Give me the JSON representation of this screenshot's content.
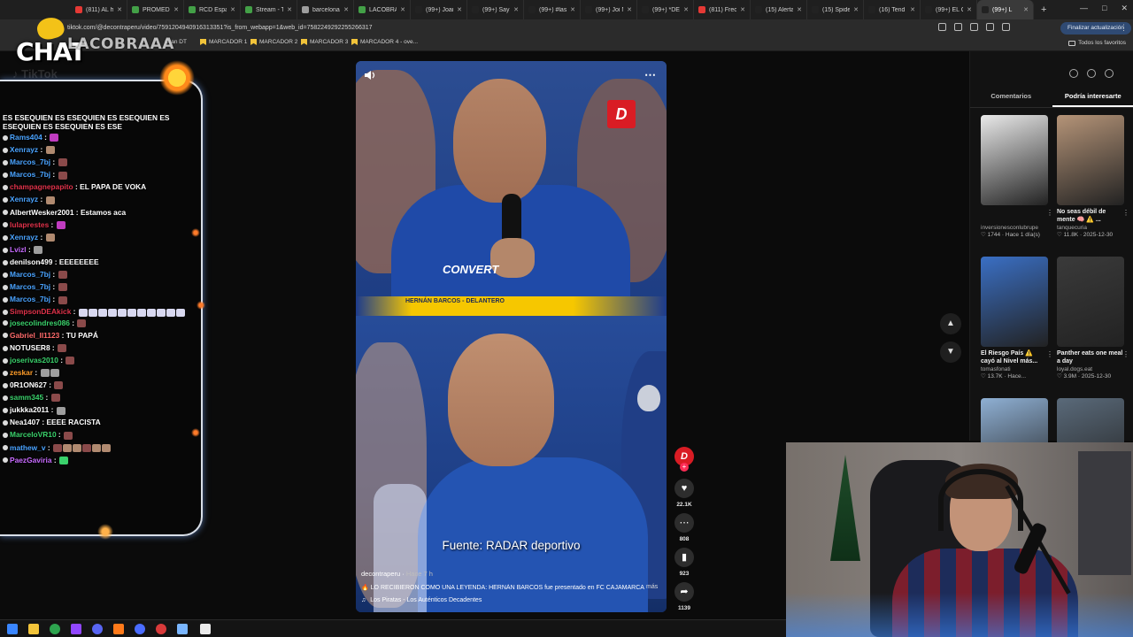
{
  "browser": {
    "tabs": [
      {
        "label": "(811) AL hi",
        "color": "#e53935"
      },
      {
        "label": "PROMEDI",
        "color": "#43a047"
      },
      {
        "label": "RCD Espa",
        "color": "#43a047"
      },
      {
        "label": "Stream - T",
        "color": "#43a047"
      },
      {
        "label": "barcelona",
        "color": "#9e9e9e"
      },
      {
        "label": "LACOBRA",
        "color": "#43a047"
      },
      {
        "label": "(99+) Joan",
        "color": "#222222"
      },
      {
        "label": "(99+) Say",
        "color": "#222222"
      },
      {
        "label": "(99+) #lass",
        "color": "#222222"
      },
      {
        "label": "(99+) Joi Ni",
        "color": "#222222"
      },
      {
        "label": "(99+) *DES",
        "color": "#222222"
      },
      {
        "label": "(811) Frec",
        "color": "#e53935"
      },
      {
        "label": "(15) Alerta",
        "color": "#222222"
      },
      {
        "label": "(15) Spide",
        "color": "#222222"
      },
      {
        "label": "(16) Tend",
        "color": "#222222"
      },
      {
        "label": "(99+) EL C",
        "color": "#222222"
      },
      {
        "label": "(99+) L",
        "color": "#222222",
        "active": true
      }
    ],
    "url": "tiktok.com/@decontraperu/video/7591204940916313351?is_from_webapp=1&web_id=7582249292255266317",
    "update_button": "Finalizar actualización",
    "bookmarks": [
      "Gran DT",
      "MARCADOR 1",
      "MARCADOR 2",
      "MARCADOR 3",
      "MARCADOR 4 - ove..."
    ],
    "all_favorites": "Todos los favoritos"
  },
  "overlay": {
    "chat_logo": "CHAT",
    "channel_name": "LACOBRAAA"
  },
  "chat": {
    "header": "ES ESEQUIEN ES ESEQUIEN ES ESEQUIEN ES ESEQUIEN ES ESEQUIEN ES ESE",
    "messages": [
      {
        "user": "Rams404",
        "text": "",
        "color": "#4aa3ff",
        "emotes": [
          "#c03cc0"
        ]
      },
      {
        "user": "Xenrayz",
        "text": "",
        "color": "#4aa3ff",
        "emotes": [
          "#b08a70"
        ]
      },
      {
        "user": "Marcos_7bj",
        "text": "",
        "color": "#4aa3ff",
        "emotes": [
          "#8a4a4a"
        ]
      },
      {
        "user": "Marcos_7bj",
        "text": "",
        "color": "#4aa3ff",
        "emotes": [
          "#8a4a4a"
        ]
      },
      {
        "user": "champagnepapito",
        "text": "EL PAPA DE VOKA",
        "color": "#e0324a",
        "emotes": []
      },
      {
        "user": "Xenrayz",
        "text": "",
        "color": "#4aa3ff",
        "emotes": [
          "#b08a70"
        ]
      },
      {
        "user": "AlbertWesker2001",
        "text": "Estamos aca",
        "color": "#ffffff",
        "emotes": []
      },
      {
        "user": "lulaprestes",
        "text": "",
        "color": "#e0324a",
        "emotes": [
          "#c03cc0"
        ]
      },
      {
        "user": "Xenrayz",
        "text": "",
        "color": "#4aa3ff",
        "emotes": [
          "#b08a70"
        ]
      },
      {
        "user": "Lvizl",
        "text": "",
        "color": "#c86bff",
        "emotes": [
          "#9e9e9e"
        ]
      },
      {
        "user": "denilson499",
        "text": "EEEEEEEE",
        "color": "#ffffff",
        "emotes": []
      },
      {
        "user": "Marcos_7bj",
        "text": "",
        "color": "#4aa3ff",
        "emotes": [
          "#8a4a4a"
        ]
      },
      {
        "user": "Marcos_7bj",
        "text": "",
        "color": "#4aa3ff",
        "emotes": [
          "#8a4a4a"
        ]
      },
      {
        "user": "Marcos_7bj",
        "text": "",
        "color": "#4aa3ff",
        "emotes": [
          "#8a4a4a"
        ]
      },
      {
        "user": "SimpsonDEAkick",
        "text": "",
        "color": "#e0324a",
        "emotes": [
          "#d8d8f0",
          "#d8d8f0",
          "#d8d8f0",
          "#d8d8f0",
          "#d8d8f0",
          "#d8d8f0",
          "#d8d8f0",
          "#d8d8f0",
          "#d8d8f0",
          "#d8d8f0",
          "#d8d8f0"
        ],
        "wrap": true
      },
      {
        "user": "josecolindres086",
        "text": "",
        "color": "#3ad16b",
        "emotes": [
          "#8a4a4a"
        ]
      },
      {
        "user": "Gabriel_II1123",
        "text": "TU PAPÁ",
        "color": "#ff6b6b",
        "emotes": []
      },
      {
        "user": "NOTUSER8",
        "text": "",
        "color": "#ffffff",
        "emotes": [
          "#8a4a4a"
        ]
      },
      {
        "user": "joserivas2010",
        "text": "",
        "color": "#3ad16b",
        "emotes": [
          "#8a4a4a"
        ]
      },
      {
        "user": "zeskar",
        "text": "",
        "color": "#ff9d2a",
        "emotes": [
          "#9e9e9e",
          "#9e9e9e"
        ]
      },
      {
        "user": "0R1ON627",
        "text": "",
        "color": "#ffffff",
        "emotes": [
          "#8a4a4a"
        ]
      },
      {
        "user": "samm345",
        "text": "",
        "color": "#3ad16b",
        "emotes": [
          "#8a4a4a"
        ]
      },
      {
        "user": "jukkka2011",
        "text": "",
        "color": "#ffffff",
        "emotes": [
          "#9e9e9e"
        ]
      },
      {
        "user": "Nea1407",
        "text": "EEEE RACISTA",
        "color": "#ffffff",
        "emotes": []
      },
      {
        "user": "MarceloVR10",
        "text": "",
        "color": "#3ad16b",
        "emotes": [
          "#8a4a4a"
        ]
      },
      {
        "user": "mathew_v",
        "text": "",
        "color": "#4aa3ff",
        "emotes": [
          "#8a4a4a",
          "#b08a70",
          "#b08a70",
          "#8a4a4a",
          "#b08a70",
          "#b08a70"
        ]
      },
      {
        "user": "PaezGaviria",
        "text": "",
        "color": "#c86bff",
        "emotes": [
          "#3ad16b"
        ]
      }
    ]
  },
  "video": {
    "sponsor_text": "CONVERT",
    "lower_third": "HERNÁN BARCOS - DELANTERO",
    "caption_source": "Fuente: RADAR deportivo",
    "author": "decontraperu",
    "ago": "Hace 7 h",
    "description": "🔥 LO RECIBIERON COMO UNA LEYENDA: HERNÁN BARCOS fue presentado en FC CAJAMARCA",
    "more": "más",
    "music": "Los Piratas - Los Auténticos Decadentes",
    "brand_letter": "D"
  },
  "actions": {
    "likes": "22.1K",
    "comments": "808",
    "saves": "923",
    "shares": "1139"
  },
  "side_panel": {
    "tabs": [
      "Comentarios",
      "Podría interesarte"
    ],
    "active_tab": 1,
    "recommendations": [
      {
        "title": "",
        "user": "inversionesconlubrupe",
        "stats": "1744 · Hace 1 día(s)",
        "color": "#e9e9e9"
      },
      {
        "title": "No seas débil de mente 🧠 ⚠️ ...",
        "user": "tanquecuria",
        "stats": "11.8K · 2025-12-30",
        "color": "#b59478"
      },
      {
        "title": "El Riesgo País ⚠️ cayó al Nivel más...",
        "user": "tomasfonati",
        "stats": "13.7K · Hace...",
        "color": "#3a6fc4"
      },
      {
        "title": "Panther eats one meal a day",
        "user": "loyal.dogs.eat",
        "stats": "3.9M · 2025-12-30",
        "color": "#3a3a3a"
      },
      {
        "title": "",
        "user": "",
        "stats": "",
        "color": "#8fb0d4"
      },
      {
        "title": "",
        "user": "",
        "stats": "",
        "color": "#5a6a7a"
      }
    ]
  }
}
